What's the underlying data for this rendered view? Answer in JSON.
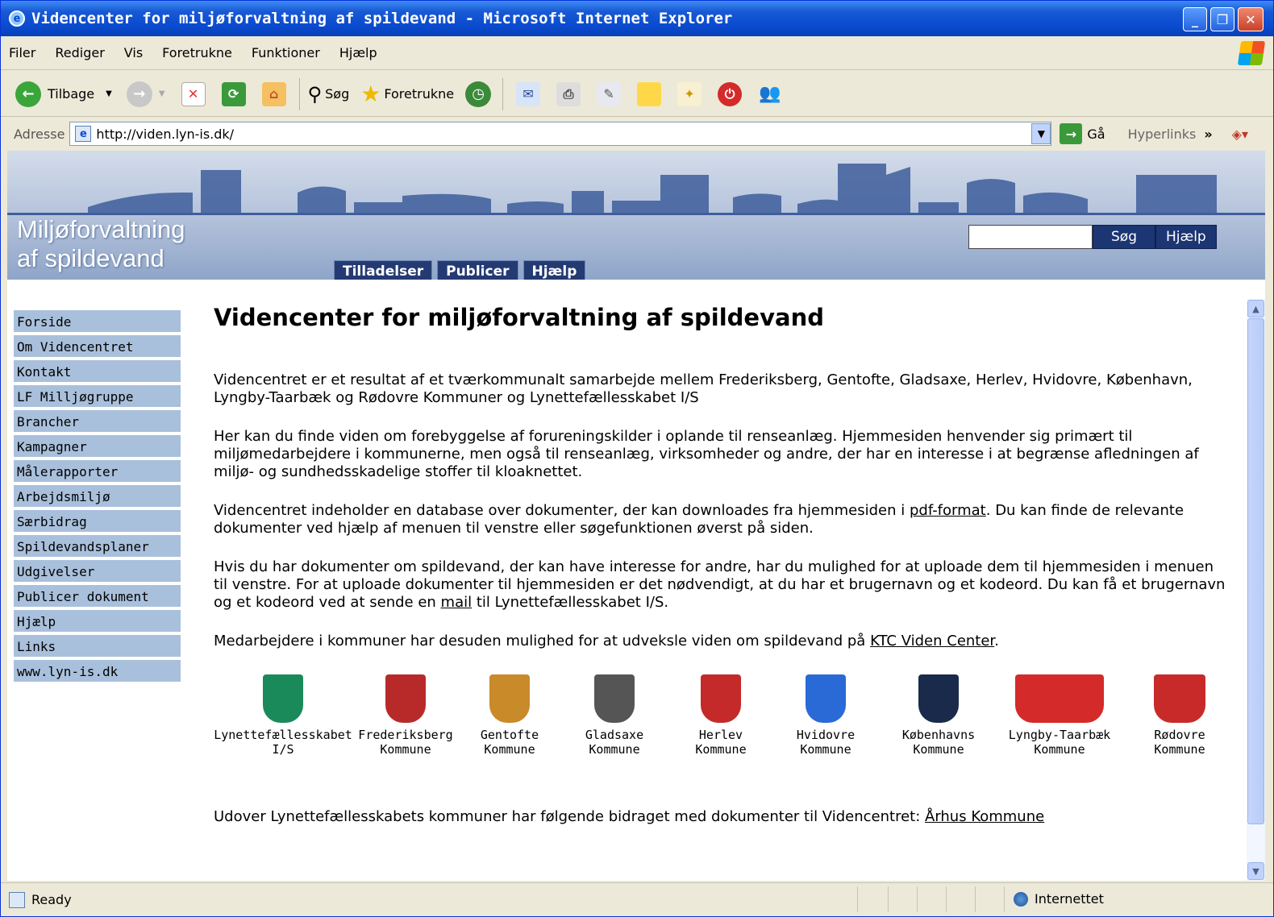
{
  "window": {
    "title": "Videncenter for miljøforvaltning af spildevand - Microsoft Internet Explorer"
  },
  "menubar": [
    "Filer",
    "Rediger",
    "Vis",
    "Foretrukne",
    "Funktioner",
    "Hjælp"
  ],
  "toolbar": {
    "back": "Tilbage",
    "search": "Søg",
    "favorites": "Foretrukne"
  },
  "address": {
    "label": "Adresse",
    "url": "http://viden.lyn-is.dk/",
    "go": "Gå",
    "links": "Hyperlinks"
  },
  "banner": {
    "line1": "Miljøforvaltning",
    "line2": "af spildevand"
  },
  "search": {
    "button": "Søg",
    "help": "Hjælp"
  },
  "tabs": [
    "Tilladelser",
    "Publicer",
    "Hjælp"
  ],
  "sidebar": [
    "Forside",
    "Om Videncentret",
    "Kontakt",
    "LF Milljøgruppe",
    "Brancher",
    "Kampagner",
    "Målerapporter",
    "Arbejdsmiljø",
    "Særbidrag",
    "Spildevandsplaner",
    "Udgivelser",
    "Publicer dokument",
    "Hjælp",
    "Links",
    "www.lyn-is.dk"
  ],
  "main": {
    "heading": "Videncenter for miljøforvaltning af spildevand",
    "p1": "Videncentret er et resultat af et tværkommunalt samarbejde mellem Frederiksberg, Gentofte, Gladsaxe, Herlev, Hvidovre, København, Lyngby-Taarbæk og Rødovre Kommuner og Lynettefællesskabet I/S",
    "p2": "Her kan du finde viden om forebyggelse af forureningskilder i oplande til renseanlæg. Hjemmesiden henvender sig primært til miljømedarbejdere i kommunerne, men også til renseanlæg, virksomheder og andre, der har en interesse i at begrænse afledningen af miljø- og sundhedsskadelige stoffer til kloaknettet.",
    "p3a": "Videncentret indeholder en database over dokumenter, der kan downloades fra hjemmesiden i ",
    "p3link": "pdf-format",
    "p3b": ". Du kan finde de relevante dokumenter ved hjælp af menuen til venstre eller søgefunktionen øverst på siden.",
    "p4a": "Hvis du har dokumenter om spildevand, der kan have interesse for andre, har du mulighed for at uploade dem til hjemmesiden i menuen til venstre. For at uploade dokumenter til hjemmesiden er det nødvendigt, at du har et brugernavn og et kodeord. Du kan få et brugernavn og et kodeord ved at sende en ",
    "p4link": "mail",
    "p4b": " til Lynettefællesskabet I/S.",
    "p5a": "Medarbejdere i kommuner har desuden mulighed for at udveksle viden om spildevand på ",
    "p5link": "KTC Viden Center",
    "p5b": ".",
    "footnote": "Udover Lynettefællesskabets kommuner har følgende bidraget med dokumenter til Videncentret: ",
    "footlink": "Århus Kommune"
  },
  "logos": [
    {
      "l1": "Lynettefællesskabet",
      "l2": "I/S",
      "color": "#1a8a5a"
    },
    {
      "l1": "Frederiksberg",
      "l2": "Kommune",
      "color": "#b82a2a"
    },
    {
      "l1": "Gentofte",
      "l2": "Kommune",
      "color": "#c98a2a"
    },
    {
      "l1": "Gladsaxe",
      "l2": "Kommune",
      "color": "#555555"
    },
    {
      "l1": "Herlev",
      "l2": "Kommune",
      "color": "#c42a2a"
    },
    {
      "l1": "Hvidovre",
      "l2": "Kommune",
      "color": "#2a6ad6"
    },
    {
      "l1": "Københavns",
      "l2": "Kommune",
      "color": "#1a2a4a"
    },
    {
      "l1": "Lyngby-Taarbæk",
      "l2": "Kommune",
      "color": "#d42a2a"
    },
    {
      "l1": "Rødovre",
      "l2": "Kommune",
      "color": "#c82a2a"
    }
  ],
  "status": {
    "text": "Ready",
    "zone": "Internettet"
  }
}
